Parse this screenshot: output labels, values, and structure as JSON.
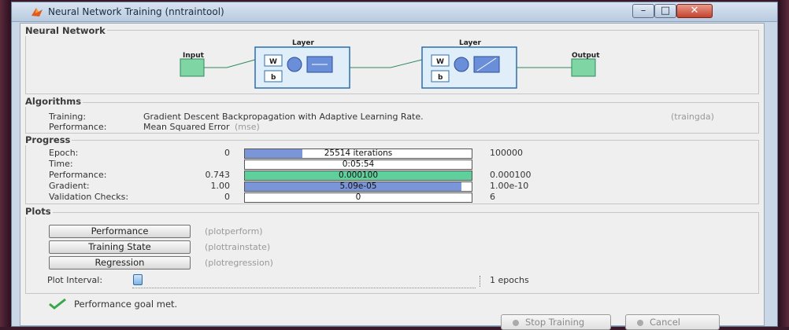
{
  "window": {
    "title": "Neural Network Training (nntraintool)"
  },
  "network": {
    "section_title": "Neural Network",
    "input_label": "Input",
    "output_label": "Output",
    "layers": [
      {
        "label": "Layer",
        "w": "W",
        "b": "b"
      },
      {
        "label": "Layer",
        "w": "W",
        "b": "b"
      }
    ]
  },
  "algorithms": {
    "section_title": "Algorithms",
    "training_label": "Training:",
    "training_value": "Gradient Descent Backpropagation with Adaptive Learning Rate.",
    "training_func": "(traingda)",
    "performance_label": "Performance:",
    "performance_value": "Mean Squared Error",
    "performance_func": "(mse)"
  },
  "progress": {
    "section_title": "Progress",
    "rows": [
      {
        "label": "Epoch:",
        "start": "0",
        "bar_text": "25514 iterations",
        "end": "100000",
        "fill": 0.255,
        "color": "#7b96d8"
      },
      {
        "label": "Time:",
        "start": "",
        "bar_text": "0:05:54",
        "end": "",
        "fill": 0,
        "color": "#7b96d8"
      },
      {
        "label": "Performance:",
        "start": "0.743",
        "bar_text": "0.000100",
        "end": "0.000100",
        "fill": 1.0,
        "color": "#5fd09c"
      },
      {
        "label": "Gradient:",
        "start": "1.00",
        "bar_text": "5.09e-05",
        "end": "1.00e-10",
        "fill": 0.955,
        "color": "#7b96d8"
      },
      {
        "label": "Validation Checks:",
        "start": "0",
        "bar_text": "0",
        "end": "6",
        "fill": 0,
        "color": "#7b96d8"
      }
    ]
  },
  "plots": {
    "section_title": "Plots",
    "buttons": [
      {
        "label": "Performance",
        "func": "(plotperform)"
      },
      {
        "label": "Training State",
        "func": "(plottrainstate)"
      },
      {
        "label": "Regression",
        "func": "(plotregression)"
      }
    ],
    "interval_label": "Plot Interval:",
    "interval_value": "1 epochs",
    "interval_level": 0
  },
  "status": {
    "message": "Performance goal met."
  },
  "footer": {
    "stop_label": "Stop Training",
    "cancel_label": "Cancel"
  }
}
